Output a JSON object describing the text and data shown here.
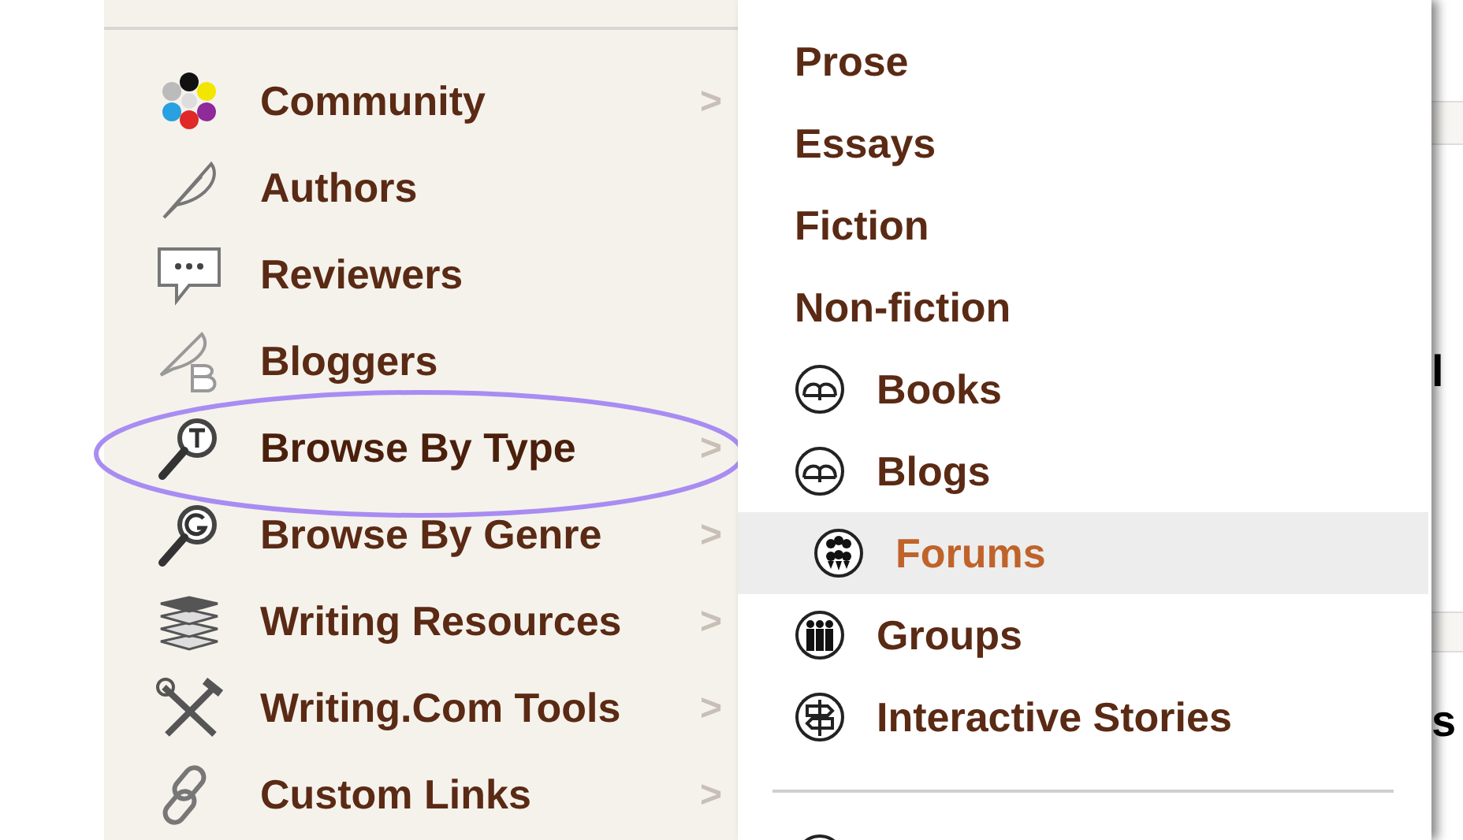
{
  "menu": {
    "items": [
      {
        "label": "Community",
        "kind": "dots",
        "has_submenu": true,
        "selected": false
      },
      {
        "label": "Authors",
        "kind": "quill",
        "has_submenu": false,
        "selected": false
      },
      {
        "label": "Reviewers",
        "kind": "speech",
        "has_submenu": false,
        "selected": false
      },
      {
        "label": "Bloggers",
        "kind": "quillb",
        "has_submenu": false,
        "selected": false
      },
      {
        "label": "Browse By Type",
        "kind": "lenst",
        "has_submenu": true,
        "selected": true
      },
      {
        "label": "Browse By Genre",
        "kind": "lensg",
        "has_submenu": true,
        "selected": false
      },
      {
        "label": "Writing Resources",
        "kind": "stack",
        "has_submenu": true,
        "selected": false
      },
      {
        "label": "Writing.Com Tools",
        "kind": "tools",
        "has_submenu": true,
        "selected": false
      },
      {
        "label": "Custom Links",
        "kind": "chain",
        "has_submenu": true,
        "selected": false
      }
    ],
    "chevron": ">"
  },
  "submenu": {
    "items": [
      {
        "label": "Prose",
        "kind": "plain",
        "selected": false
      },
      {
        "label": "Essays",
        "kind": "plain",
        "selected": false
      },
      {
        "label": "Fiction",
        "kind": "plain",
        "selected": false
      },
      {
        "label": "Non-fiction",
        "kind": "plain",
        "selected": false
      },
      {
        "label": "Books",
        "kind": "book",
        "selected": false
      },
      {
        "label": "Blogs",
        "kind": "book",
        "selected": false
      },
      {
        "label": "Forums",
        "kind": "crowd",
        "selected": true
      },
      {
        "label": "Groups",
        "kind": "group",
        "selected": false
      },
      {
        "label": "Interactive Stories",
        "kind": "signpost",
        "selected": false
      }
    ]
  },
  "page_fragments": [
    "l",
    "s"
  ]
}
